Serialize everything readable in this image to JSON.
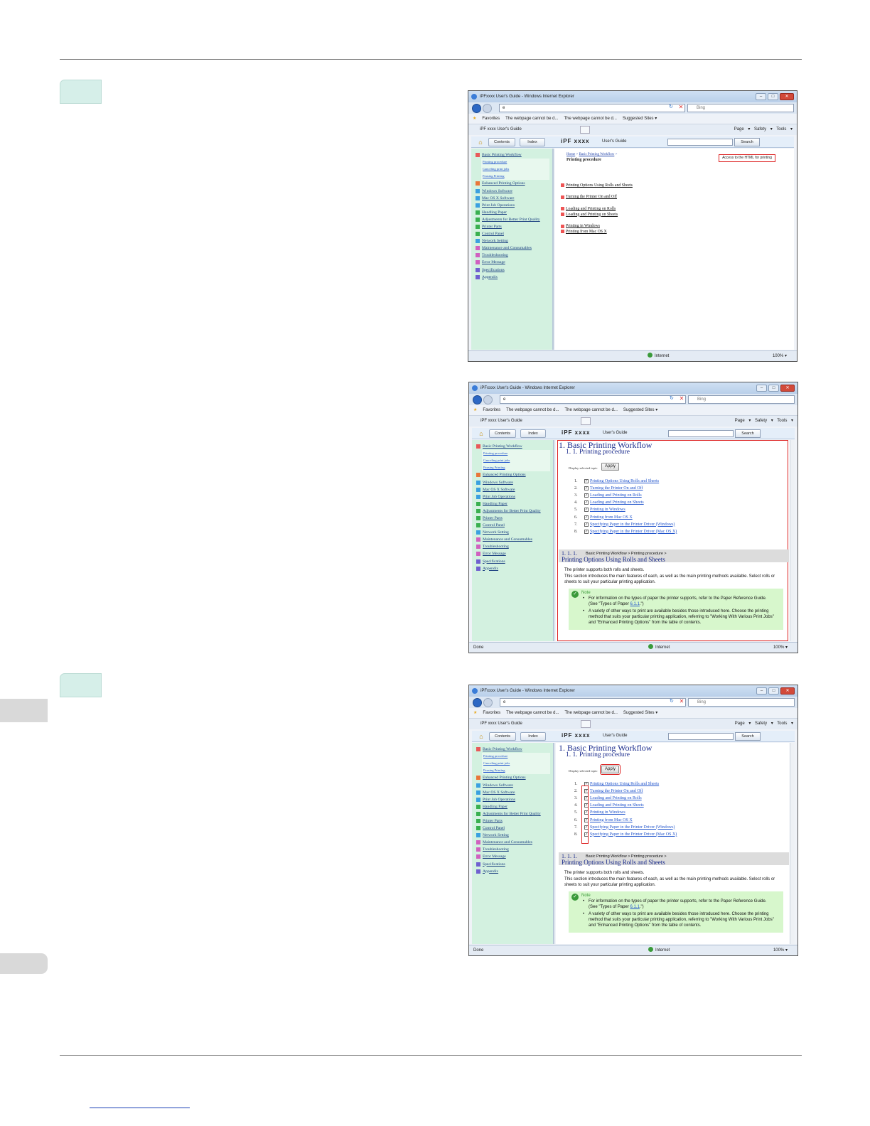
{
  "window": {
    "title": "iPFxxxx  User's Guide - Windows Internet Explorer",
    "address": "e",
    "search_placeholder": "Bing",
    "favorites_label": "Favorites",
    "fav_links": [
      "The webpage cannot be d...",
      "The webpage cannot be d...",
      "Suggested Sites ▾"
    ],
    "tab_label": "iPF xxxx  User's Guide",
    "tools_label": "Page ▾  Safety ▾  Tools ▾",
    "min_btn": "–",
    "max_btn": "□",
    "close_btn": "✕",
    "refresh": "↻",
    "stop": "✕"
  },
  "guide": {
    "contents_tab": "Contents",
    "index_tab": "Index",
    "brand": "iPF xxxx",
    "label": "User's Guide",
    "search_button": "Search"
  },
  "status": {
    "done": "Done",
    "zone": "Internet",
    "zoom": "100%  ▾"
  },
  "nav": {
    "top_item": "Basic Printing Workflow",
    "subitems": [
      "Printing procedure",
      "Canceling print jobs",
      "Pausing Printing"
    ],
    "items": [
      {
        "label": "Enhanced Printing Options",
        "color": "#e8763a"
      },
      {
        "label": "Windows Software",
        "color": "#3aa0e0"
      },
      {
        "label": "Mac OS X Software",
        "color": "#3aa0e0"
      },
      {
        "label": "Print Job Operations",
        "color": "#3aa0e0"
      },
      {
        "label": "Handling Paper",
        "color": "#3ab050"
      },
      {
        "label": "Adjustments for Better Print Quality",
        "color": "#3ab050"
      },
      {
        "label": "Printer Parts",
        "color": "#3ab050"
      },
      {
        "label": "Control Panel",
        "color": "#3ab050"
      },
      {
        "label": "Network Setting",
        "color": "#3aa0e0"
      },
      {
        "label": "Maintenance and Consumables",
        "color": "#d060c0"
      },
      {
        "label": "Troubleshooting",
        "color": "#d060c0"
      },
      {
        "label": "Error Message",
        "color": "#d060c0"
      },
      {
        "label": "Specifications",
        "color": "#7060d0"
      },
      {
        "label": "Appendix",
        "color": "#7060d0"
      }
    ]
  },
  "page1": {
    "breadcrumb_home": "Home",
    "breadcrumb_mid": "Basic Printing Workflow",
    "title": "Printing procedure",
    "print_button": "Access to the HTML for printing",
    "groups": [
      [
        "Printing Options Using Rolls and Sheets"
      ],
      [
        "Turning the Printer On and Off"
      ],
      [
        "Loading and Printing on Rolls",
        "Loading and Printing on Sheets"
      ],
      [
        "Printing in Windows",
        "Printing from Mac OS X"
      ]
    ]
  },
  "page2": {
    "h1": "1. Basic Printing Workflow",
    "h2": "1. 1. Printing procedure",
    "display_selected": "Display selected topic",
    "apply": "Apply",
    "list": [
      "Printing Options Using Rolls and Sheets",
      "Turning the Printer On and Off",
      "Loading and Printing on Rolls",
      "Loading and Printing on Sheets",
      "Printing in Windows",
      "Printing from Mac OS X",
      "Specifying Paper in the Printer Driver (Windows)",
      "Specifying Paper in the Printer Driver (Mac OS X)"
    ],
    "section_num": "1. 1. 1.",
    "section_path": "Basic Printing Workflow > Printing procedure >",
    "section_title": "Printing Options Using Rolls and Sheets",
    "body1": "The printer supports both rolls and sheets.",
    "body2": "This section introduces the main features of each, as well as the main printing methods available. Select rolls or sheets to suit your particular printing application.",
    "note_label": "Note",
    "note1a": "For information on the types of paper the printer supports, refer to the Paper Reference Guide.  (See \"Types of Paper",
    "note1_link": "6.1.1",
    "note1b": ".\")",
    "note2": "A variety of other ways to print are available besides those introduced here. Choose the printing method that suits your particular printing application, referring to \"Working With Various Print Jobs\" and \"Enhanced Printing Options\" from the table of contents."
  }
}
